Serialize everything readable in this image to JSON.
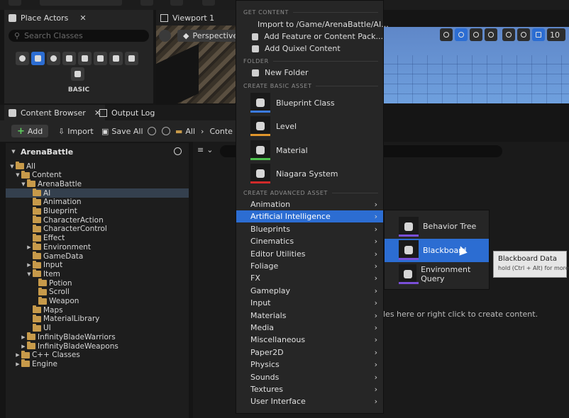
{
  "toolbar_top": {
    "selection_mode": "Selection Mode"
  },
  "place_actors": {
    "title": "Place Actors",
    "search_placeholder": "Search Classes",
    "category_label": "BASIC"
  },
  "viewport": {
    "title": "Viewport 1",
    "perspective": "Perspective",
    "grid_size": "10"
  },
  "content_browser": {
    "tab_title": "Content Browser",
    "output_log": "Output Log",
    "add": "Add",
    "import": "Import",
    "save_all": "Save All",
    "breadcrumb": [
      "All",
      "Conte"
    ],
    "tree_header": "ArenaBattle",
    "tree": [
      {
        "label": "All",
        "depth": 0,
        "open": true
      },
      {
        "label": "Content",
        "depth": 1,
        "open": true
      },
      {
        "label": "ArenaBattle",
        "depth": 2,
        "open": true
      },
      {
        "label": "AI",
        "depth": 3,
        "selected": true
      },
      {
        "label": "Animation",
        "depth": 3
      },
      {
        "label": "Blueprint",
        "depth": 3
      },
      {
        "label": "CharacterAction",
        "depth": 3
      },
      {
        "label": "CharacterControl",
        "depth": 3
      },
      {
        "label": "Effect",
        "depth": 3
      },
      {
        "label": "Environment",
        "depth": 3,
        "collapsed": true
      },
      {
        "label": "GameData",
        "depth": 3
      },
      {
        "label": "Input",
        "depth": 3,
        "collapsed": true
      },
      {
        "label": "Item",
        "depth": 3,
        "open": true
      },
      {
        "label": "Potion",
        "depth": 4
      },
      {
        "label": "Scroll",
        "depth": 4
      },
      {
        "label": "Weapon",
        "depth": 4
      },
      {
        "label": "Maps",
        "depth": 3
      },
      {
        "label": "MaterialLibrary",
        "depth": 3
      },
      {
        "label": "UI",
        "depth": 3
      },
      {
        "label": "InfinityBladeWarriors",
        "depth": 2,
        "collapsed": true
      },
      {
        "label": "InfinityBladeWeapons",
        "depth": 2,
        "collapsed": true
      },
      {
        "label": "C++ Classes",
        "depth": 1,
        "collapsed": true
      },
      {
        "label": "Engine",
        "depth": 1,
        "collapsed": true
      }
    ],
    "empty_hint": "les here or right click to create content."
  },
  "menu": {
    "get_content_header": "GET CONTENT",
    "get_content": [
      "Import to /Game/ArenaBattle/AI...",
      "Add Feature or Content Pack...",
      "Add Quixel Content"
    ],
    "folder_header": "FOLDER",
    "new_folder": "New Folder",
    "basic_header": "CREATE BASIC ASSET",
    "basic_assets": [
      {
        "label": "Blueprint Class",
        "color": "#3b7be0"
      },
      {
        "label": "Level",
        "color": "#e0962c"
      },
      {
        "label": "Material",
        "color": "#4ec24e"
      },
      {
        "label": "Niagara System",
        "color": "#d02a2a"
      }
    ],
    "advanced_header": "CREATE ADVANCED ASSET",
    "advanced": [
      "Animation",
      "Artificial Intelligence",
      "Blueprints",
      "Cinematics",
      "Editor Utilities",
      "Foliage",
      "FX",
      "Gameplay",
      "Input",
      "Materials",
      "Media",
      "Miscellaneous",
      "Paper2D",
      "Physics",
      "Sounds",
      "Textures",
      "User Interface"
    ],
    "highlighted": "Artificial Intelligence"
  },
  "submenu": {
    "items": [
      {
        "label": "Behavior Tree",
        "color": "#7a4fd8"
      },
      {
        "label": "Blackboard",
        "color": "#7a4fd8"
      },
      {
        "label": "Environment Query",
        "color": "#7a4fd8"
      }
    ],
    "highlighted": "Blackboard"
  },
  "tooltip": {
    "title": "Blackboard Data",
    "hint": "hold (Ctrl + Alt) for more"
  },
  "colors": {
    "accent": "#2c6dd2",
    "folder": "#c79a4a"
  }
}
